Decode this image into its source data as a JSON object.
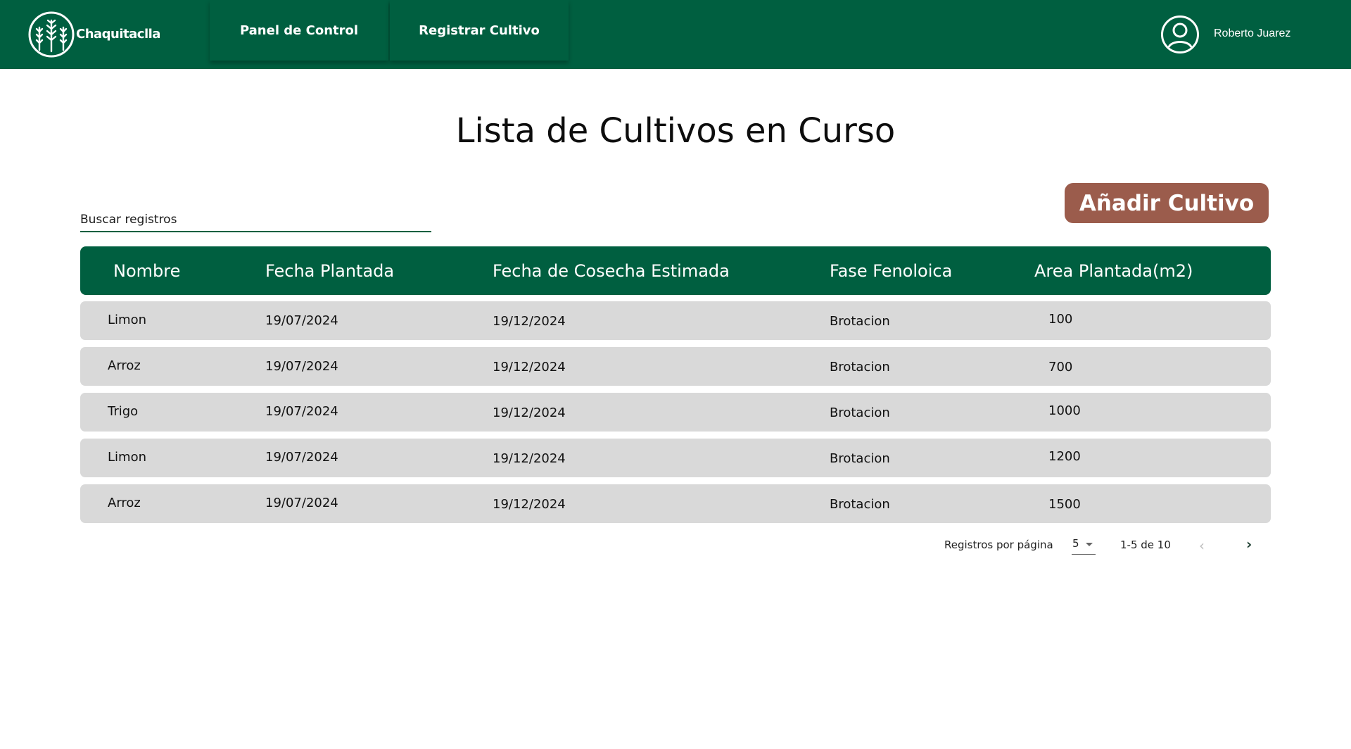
{
  "app": {
    "brand": "Chaquitaclla"
  },
  "nav": {
    "items": [
      {
        "label": "Panel de Control"
      },
      {
        "label": "Registrar Cultivo"
      }
    ]
  },
  "user": {
    "name": "Roberto Juarez"
  },
  "page": {
    "title": "Lista de Cultivos en Curso"
  },
  "search": {
    "placeholder": "Buscar registros",
    "value": ""
  },
  "actions": {
    "add_label": "Añadir Cultivo"
  },
  "table": {
    "columns": [
      "Nombre",
      "Fecha Plantada",
      "Fecha de Cosecha Estimada",
      "Fase Fenoloica",
      "Area Plantada(m2)"
    ],
    "rows": [
      [
        "Limon",
        "19/07/2024",
        "19/12/2024",
        "Brotacion",
        "100"
      ],
      [
        "Arroz",
        "19/07/2024",
        "19/12/2024",
        "Brotacion",
        "700"
      ],
      [
        "Trigo",
        "19/07/2024",
        "19/12/2024",
        "Brotacion",
        "1000"
      ],
      [
        "Limon",
        "19/07/2024",
        "19/12/2024",
        "Brotacion",
        "1200"
      ],
      [
        "Arroz",
        "19/07/2024",
        "19/12/2024",
        "Brotacion",
        "1500"
      ]
    ]
  },
  "pagination": {
    "per_page_label": "Registros por página",
    "per_page_value": "5",
    "range": "1-5 de 10",
    "prev": "‹",
    "next": "›"
  },
  "colors": {
    "primary": "#005f40",
    "accent": "#9b5c4c",
    "row": "#d9d9d9"
  },
  "icons": {
    "logo": "wheat-logo-icon",
    "user": "user-avatar-icon",
    "prev": "chevron-left-icon",
    "next": "chevron-right-icon",
    "select": "caret-down-icon"
  }
}
